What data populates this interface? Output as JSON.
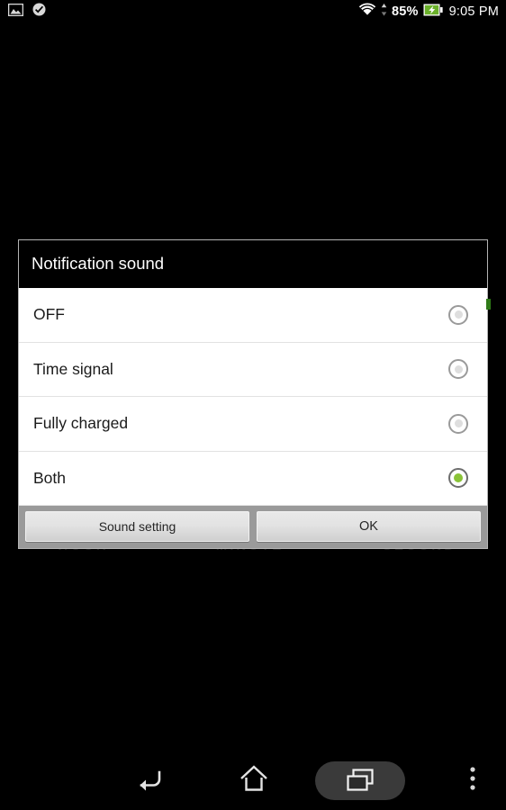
{
  "statusbar": {
    "left_icons": [
      {
        "name": "gallery-icon"
      },
      {
        "name": "check-cloud-icon"
      }
    ],
    "wifi_icon": "wifi-icon",
    "data-arrows-icon": "data-transfer-icon",
    "battery_percent": "85%",
    "battery_icon": "battery-charging-icon",
    "time": "9:05 PM"
  },
  "background": {
    "hour_label": "HOUR",
    "minute_label": "MINUTE",
    "second_label": "SECOND"
  },
  "dialog": {
    "title": "Notification sound",
    "options": [
      {
        "label": "OFF",
        "selected": false
      },
      {
        "label": "Time signal",
        "selected": false
      },
      {
        "label": "Fully charged",
        "selected": false
      },
      {
        "label": "Both",
        "selected": true
      }
    ],
    "buttons": {
      "secondary": "Sound setting",
      "primary": "OK"
    },
    "selected_color": "#8ac337",
    "scroll_indicator_color": "#2f7a18"
  },
  "navbar": {
    "back": "back-button",
    "home": "home-button",
    "recent": "recent-apps-button",
    "menu": "menu-button"
  }
}
